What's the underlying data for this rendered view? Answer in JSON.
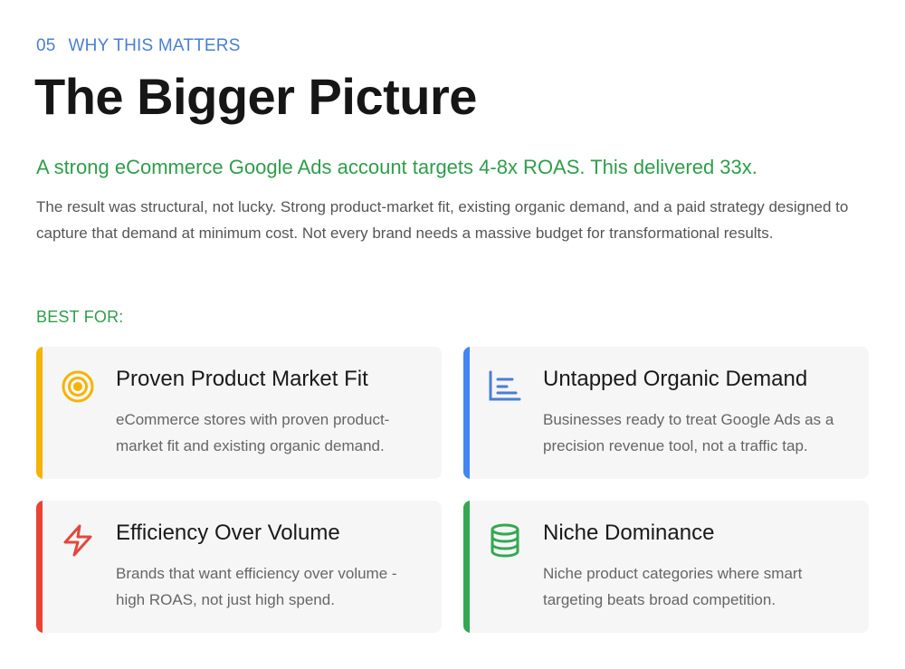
{
  "header": {
    "section_number": "05",
    "section_label": "WHY THIS MATTERS",
    "title": "The Bigger Picture"
  },
  "highlight": "A strong eCommerce Google Ads account targets 4-8x ROAS. This delivered 33x.",
  "body": "The result was structural, not lucky. Strong product-market fit, existing organic demand, and a paid strategy designed to capture that demand at minimum cost. Not every brand needs a massive budget for transformational results.",
  "best_for_label": "BEST FOR:",
  "cards": [
    {
      "title": "Proven Product Market Fit",
      "description": "eCommerce stores with proven product-market fit and existing organic demand.",
      "icon": "target-icon",
      "accent": "#f4b400"
    },
    {
      "title": "Untapped Organic Demand",
      "description": "Businesses ready to treat Google Ads as a precision revenue tool, not a traffic tap.",
      "icon": "bar-chart-icon",
      "accent": "#4285f4"
    },
    {
      "title": "Efficiency Over Volume",
      "description": "Brands that want efficiency over volume - high ROAS, not just high spend.",
      "icon": "lightning-icon",
      "accent": "#ea4335"
    },
    {
      "title": "Niche Dominance",
      "description": "Niche product categories where smart targeting beats broad competition.",
      "icon": "database-icon",
      "accent": "#34a853"
    }
  ]
}
